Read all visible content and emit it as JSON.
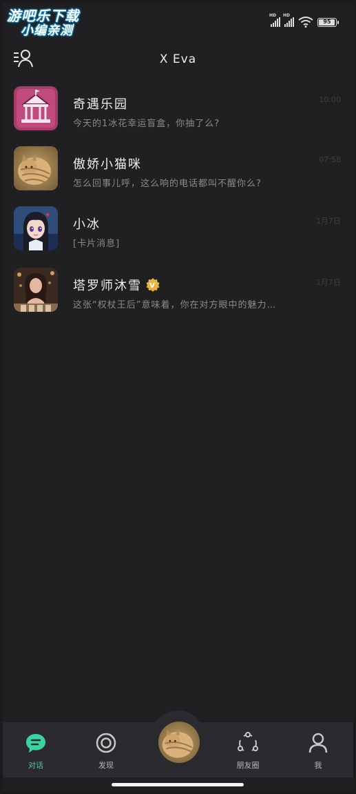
{
  "status_bar": {
    "watermark_line1": "游吧乐下载",
    "watermark_line2": "小编亲测",
    "signal1_label": "HD",
    "signal2_label": "HD",
    "battery": 95,
    "battery_text": "95"
  },
  "header": {
    "title": "X Eva",
    "menu_icon": "user-list-icon"
  },
  "chats": [
    {
      "name": "奇遇乐园",
      "preview": "今天的1冰花幸运盲盒，你抽了么?",
      "time": "10:00",
      "avatar": "carousel-icon"
    },
    {
      "name": "傲娇小猫咪",
      "preview": "怎么回事儿呼，这么响的电话都叫不醒你么?",
      "time": "07:58",
      "avatar": "cat-photo"
    },
    {
      "name": "小冰",
      "preview": "[卡片消息]",
      "time": "1月7日",
      "avatar": "anime-girl"
    },
    {
      "name": "塔罗师沐雪",
      "preview": "这张“权杖王后”意味着，你在对方眼中的魅力…",
      "time": "1月7日",
      "avatar": "tarot-woman",
      "badge": "V"
    }
  ],
  "tabs": [
    {
      "label": "对话",
      "icon": "chat-bubble-icon",
      "active": true
    },
    {
      "label": "发现",
      "icon": "discover-icon",
      "active": false
    },
    {
      "label": "朋友圈",
      "icon": "moments-icon",
      "active": false
    },
    {
      "label": "我",
      "icon": "profile-icon",
      "active": false
    }
  ],
  "colors": {
    "background": "#202023",
    "tabbar": "#2b2b2f",
    "accent": "#3ad2a0",
    "badge": "#e8b43c"
  }
}
